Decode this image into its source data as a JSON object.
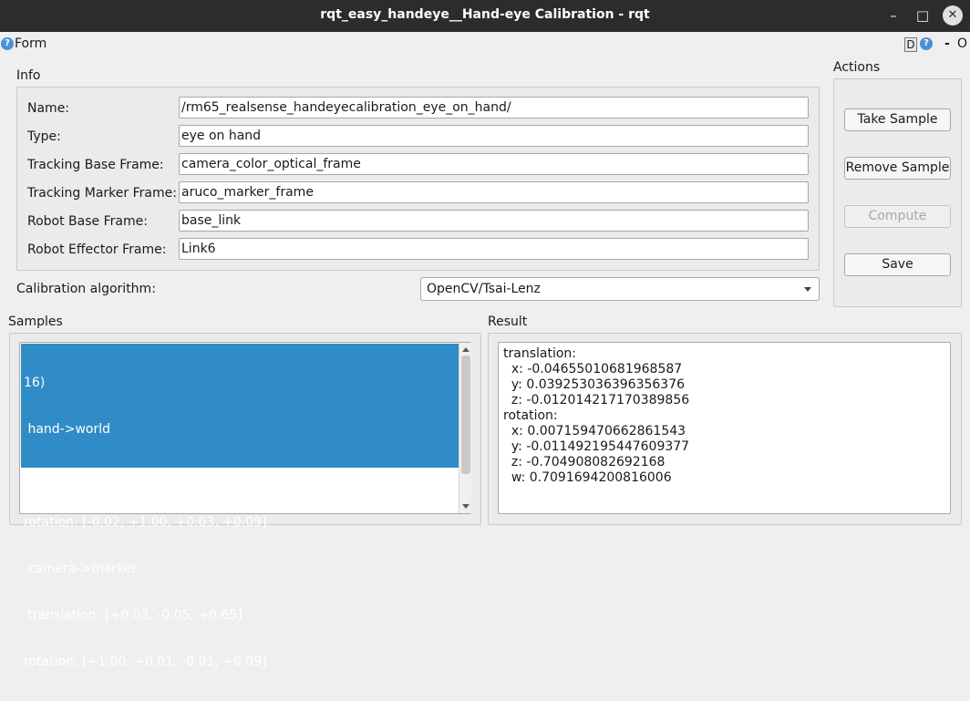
{
  "window": {
    "title": "rqt_easy_handeye__Hand-eye Calibration - rqt",
    "minimize_glyph": "–",
    "maximize_glyph": "□",
    "close_glyph": "✕"
  },
  "form_bar": {
    "help_glyph": "?",
    "label": "Form",
    "dock_label": "D",
    "help2_glyph": "?",
    "minimize_glyph": "-",
    "close_glyph": "O"
  },
  "info": {
    "title": "Info",
    "fields": [
      {
        "label": "Name:",
        "value": "/rm65_realsense_handeyecalibration_eye_on_hand/"
      },
      {
        "label": "Type:",
        "value": "eye on hand"
      },
      {
        "label": "Tracking Base Frame:",
        "value": "camera_color_optical_frame"
      },
      {
        "label": "Tracking Marker Frame:",
        "value": "aruco_marker_frame"
      },
      {
        "label": "Robot Base Frame:",
        "value": "base_link"
      },
      {
        "label": "Robot Effector Frame:",
        "value": "Link6"
      }
    ]
  },
  "algorithm": {
    "label": "Calibration algorithm:",
    "selected": "OpenCV/Tsai-Lenz"
  },
  "actions": {
    "title": "Actions",
    "take_sample": "Take Sample",
    "remove_sample": "Remove Sample",
    "compute": "Compute",
    "save": "Save"
  },
  "samples": {
    "title": "Samples",
    "selected_item": [
      "16)",
      " hand->world",
      " translation: [+0.22, -0.02, +0.33]",
      "rotation: [-0.02, +1.00, +0.03, +0.09]",
      " camera->marker",
      " translation: [+0.03, -0.05, +0.65]",
      "rotation: [+1.00, +0.01, -0.01, +0.09]"
    ]
  },
  "result": {
    "title": "Result",
    "lines": [
      "translation:",
      "  x: -0.04655010681968587",
      "  y: 0.039253036396356376",
      "  z: -0.012014217170389856",
      "rotation:",
      "  x: 0.007159470662861543",
      "  y: -0.011492195447609377",
      "  z: -0.704908082692168",
      "  w: 0.7091694200816006"
    ]
  },
  "colors": {
    "titlebar": "#2c2c2c",
    "selection": "#308cc6",
    "background": "#efefef"
  }
}
